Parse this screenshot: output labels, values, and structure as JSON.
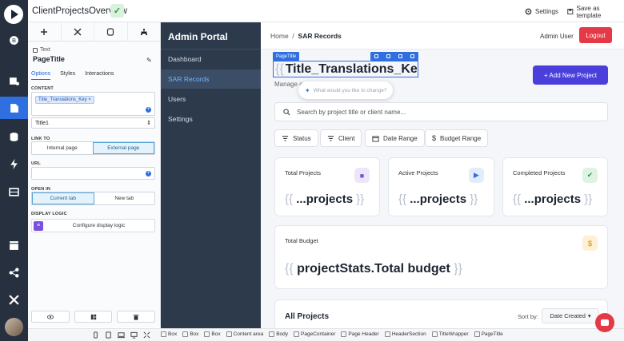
{
  "app": {
    "project_name": "ClientProjectsOverview",
    "settings_label": "Settings",
    "save_template_label": "Save as template"
  },
  "panel": {
    "element_type": "Text",
    "element_name": "PageTitle",
    "subtabs": [
      "Options",
      "Styles",
      "Interactions"
    ],
    "content_label": "CONTENT",
    "content_chip": "Title_Translations_Key",
    "heading_level": "Title1",
    "link_to_label": "LINK TO",
    "link_options": [
      "Internal page",
      "External page"
    ],
    "url_label": "URL",
    "url_value": "",
    "open_in_label": "OPEN IN",
    "open_in_options": [
      "Current tab",
      "New tab"
    ],
    "display_logic_label": "DISPLAY LOGIC",
    "display_logic_button": "Configure display logic"
  },
  "breadcrumbs": [
    "Box",
    "Box",
    "Box",
    "Content area",
    "Body",
    "PageContainer",
    "Page Header",
    "HeaderSection",
    "TitleWrapper",
    "PageTitle"
  ],
  "portal": {
    "brand": "Admin Portal",
    "nav": [
      "Dashboard",
      "SAR Records",
      "Users",
      "Settings"
    ],
    "active_nav": "SAR Records"
  },
  "header": {
    "crumb_home": "Home",
    "crumb_sep": "/",
    "crumb_current": "SAR Records",
    "user": "Admin User",
    "logout": "Logout"
  },
  "page": {
    "selection_tag": "PageTitle",
    "title_open": "{{",
    "title_key": "Title_Translations_Key",
    "title_close": "}}",
    "subtitle": "Manage a",
    "ai_prompt": "What would you like to change?",
    "add_button": "+ Add New Project",
    "search_placeholder": "Search by project title or client name...",
    "filters": [
      "Status",
      "Client",
      "Date Range",
      "Budget Range"
    ]
  },
  "stats": [
    {
      "label": "Total Projects",
      "value": "...projects",
      "icon": "folder-icon",
      "color": "#7b4fe0",
      "bg": "#ece6fb"
    },
    {
      "label": "Active Projects",
      "value": "...projects",
      "icon": "play-icon",
      "color": "#2f6fe0",
      "bg": "#e2ecfb"
    },
    {
      "label": "Completed Projects",
      "value": "...projects",
      "icon": "check-circle-icon",
      "color": "#2e9a46",
      "bg": "#dff3e4"
    }
  ],
  "budget": {
    "label": "Total Budget",
    "value": "projectStats.Total budget",
    "icon": "dollar-icon",
    "color": "#d08a00",
    "bg": "#fdf0d4"
  },
  "projects": {
    "title": "All Projects",
    "sort_label": "Sort by:",
    "sort_value": "Date Created"
  }
}
